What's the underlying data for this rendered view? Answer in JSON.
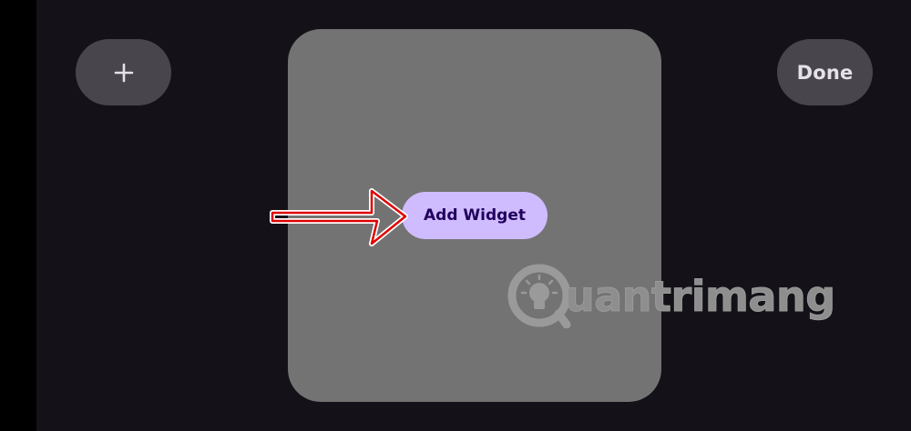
{
  "toolbar": {
    "add_icon": "plus-icon",
    "done_label": "Done"
  },
  "widget_area": {
    "add_widget_label": "Add Widget"
  },
  "annotation": {
    "arrow_color": "#e00000"
  },
  "watermark": {
    "text": "uantrimang",
    "icon": "lightbulb-icon"
  },
  "colors": {
    "background": "#141218",
    "pill": "#48464c",
    "widget_area": "#737373",
    "add_widget_bg": "#cfbcff",
    "add_widget_text": "#21005d"
  }
}
